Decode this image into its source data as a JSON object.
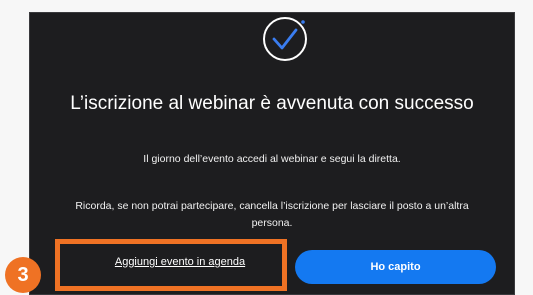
{
  "dialog": {
    "icon": "check-circle-icon",
    "title": "L’iscrizione al webinar è avvenuta con successo",
    "line_1": "Il giorno dell’evento accedi al webinar e segui la diretta.",
    "line_2": "Ricorda, se non potrai partecipare, cancella l’iscrizione per lasciare il posto a un’altra persona.",
    "secondary_button": "Aggiungi evento in agenda",
    "primary_button": "Ho capito"
  },
  "annotation": {
    "step_number": "3"
  },
  "colors": {
    "dialog_background": "#1d1d1f",
    "primary_button": "#1479f1",
    "annotation_orange": "#ef7224",
    "check_blue": "#3a7df0"
  }
}
